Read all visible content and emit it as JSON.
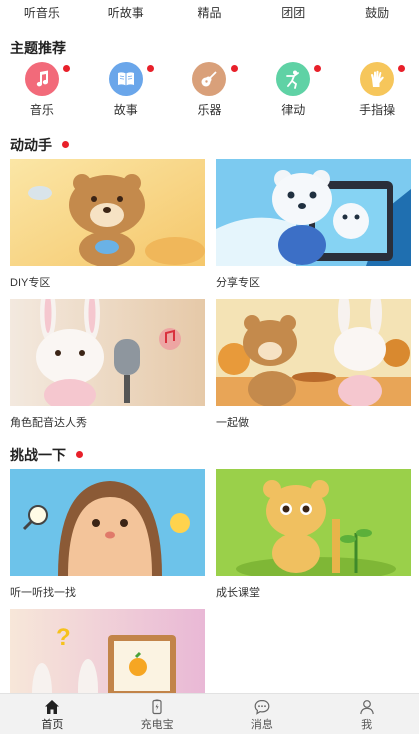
{
  "top_tabs": [
    "听音乐",
    "听故事",
    "精品",
    "团团",
    "鼓励"
  ],
  "theme_section": {
    "title": "主题推荐",
    "items": [
      {
        "label": "音乐",
        "icon": "music-note-icon",
        "color": "#f26a7a"
      },
      {
        "label": "故事",
        "icon": "book-icon",
        "color": "#6aa6ea"
      },
      {
        "label": "乐器",
        "icon": "guitar-icon",
        "color": "#d9a07a"
      },
      {
        "label": "律动",
        "icon": "dancer-icon",
        "color": "#5fd2a5"
      },
      {
        "label": "手指操",
        "icon": "hand-icon",
        "color": "#f6c65b"
      }
    ]
  },
  "hands_on_section": {
    "title": "动动手",
    "cards": [
      {
        "label": "DIY专区"
      },
      {
        "label": "分享专区"
      },
      {
        "label": "角色配音达人秀"
      },
      {
        "label": "一起做"
      }
    ]
  },
  "challenge_section": {
    "title": "挑战一下",
    "cards": [
      {
        "label": "听一听找一找"
      },
      {
        "label": "成长课堂"
      },
      {
        "label": ""
      }
    ]
  },
  "bottom_nav": [
    {
      "label": "首页",
      "icon": "home-icon",
      "active": true
    },
    {
      "label": "充电宝",
      "icon": "power-bank-icon",
      "active": false
    },
    {
      "label": "消息",
      "icon": "message-icon",
      "active": false
    },
    {
      "label": "我",
      "icon": "user-icon",
      "active": false
    }
  ],
  "colors": {
    "accent_dot": "#e8202a",
    "nav_bg": "#f2f2f2"
  }
}
